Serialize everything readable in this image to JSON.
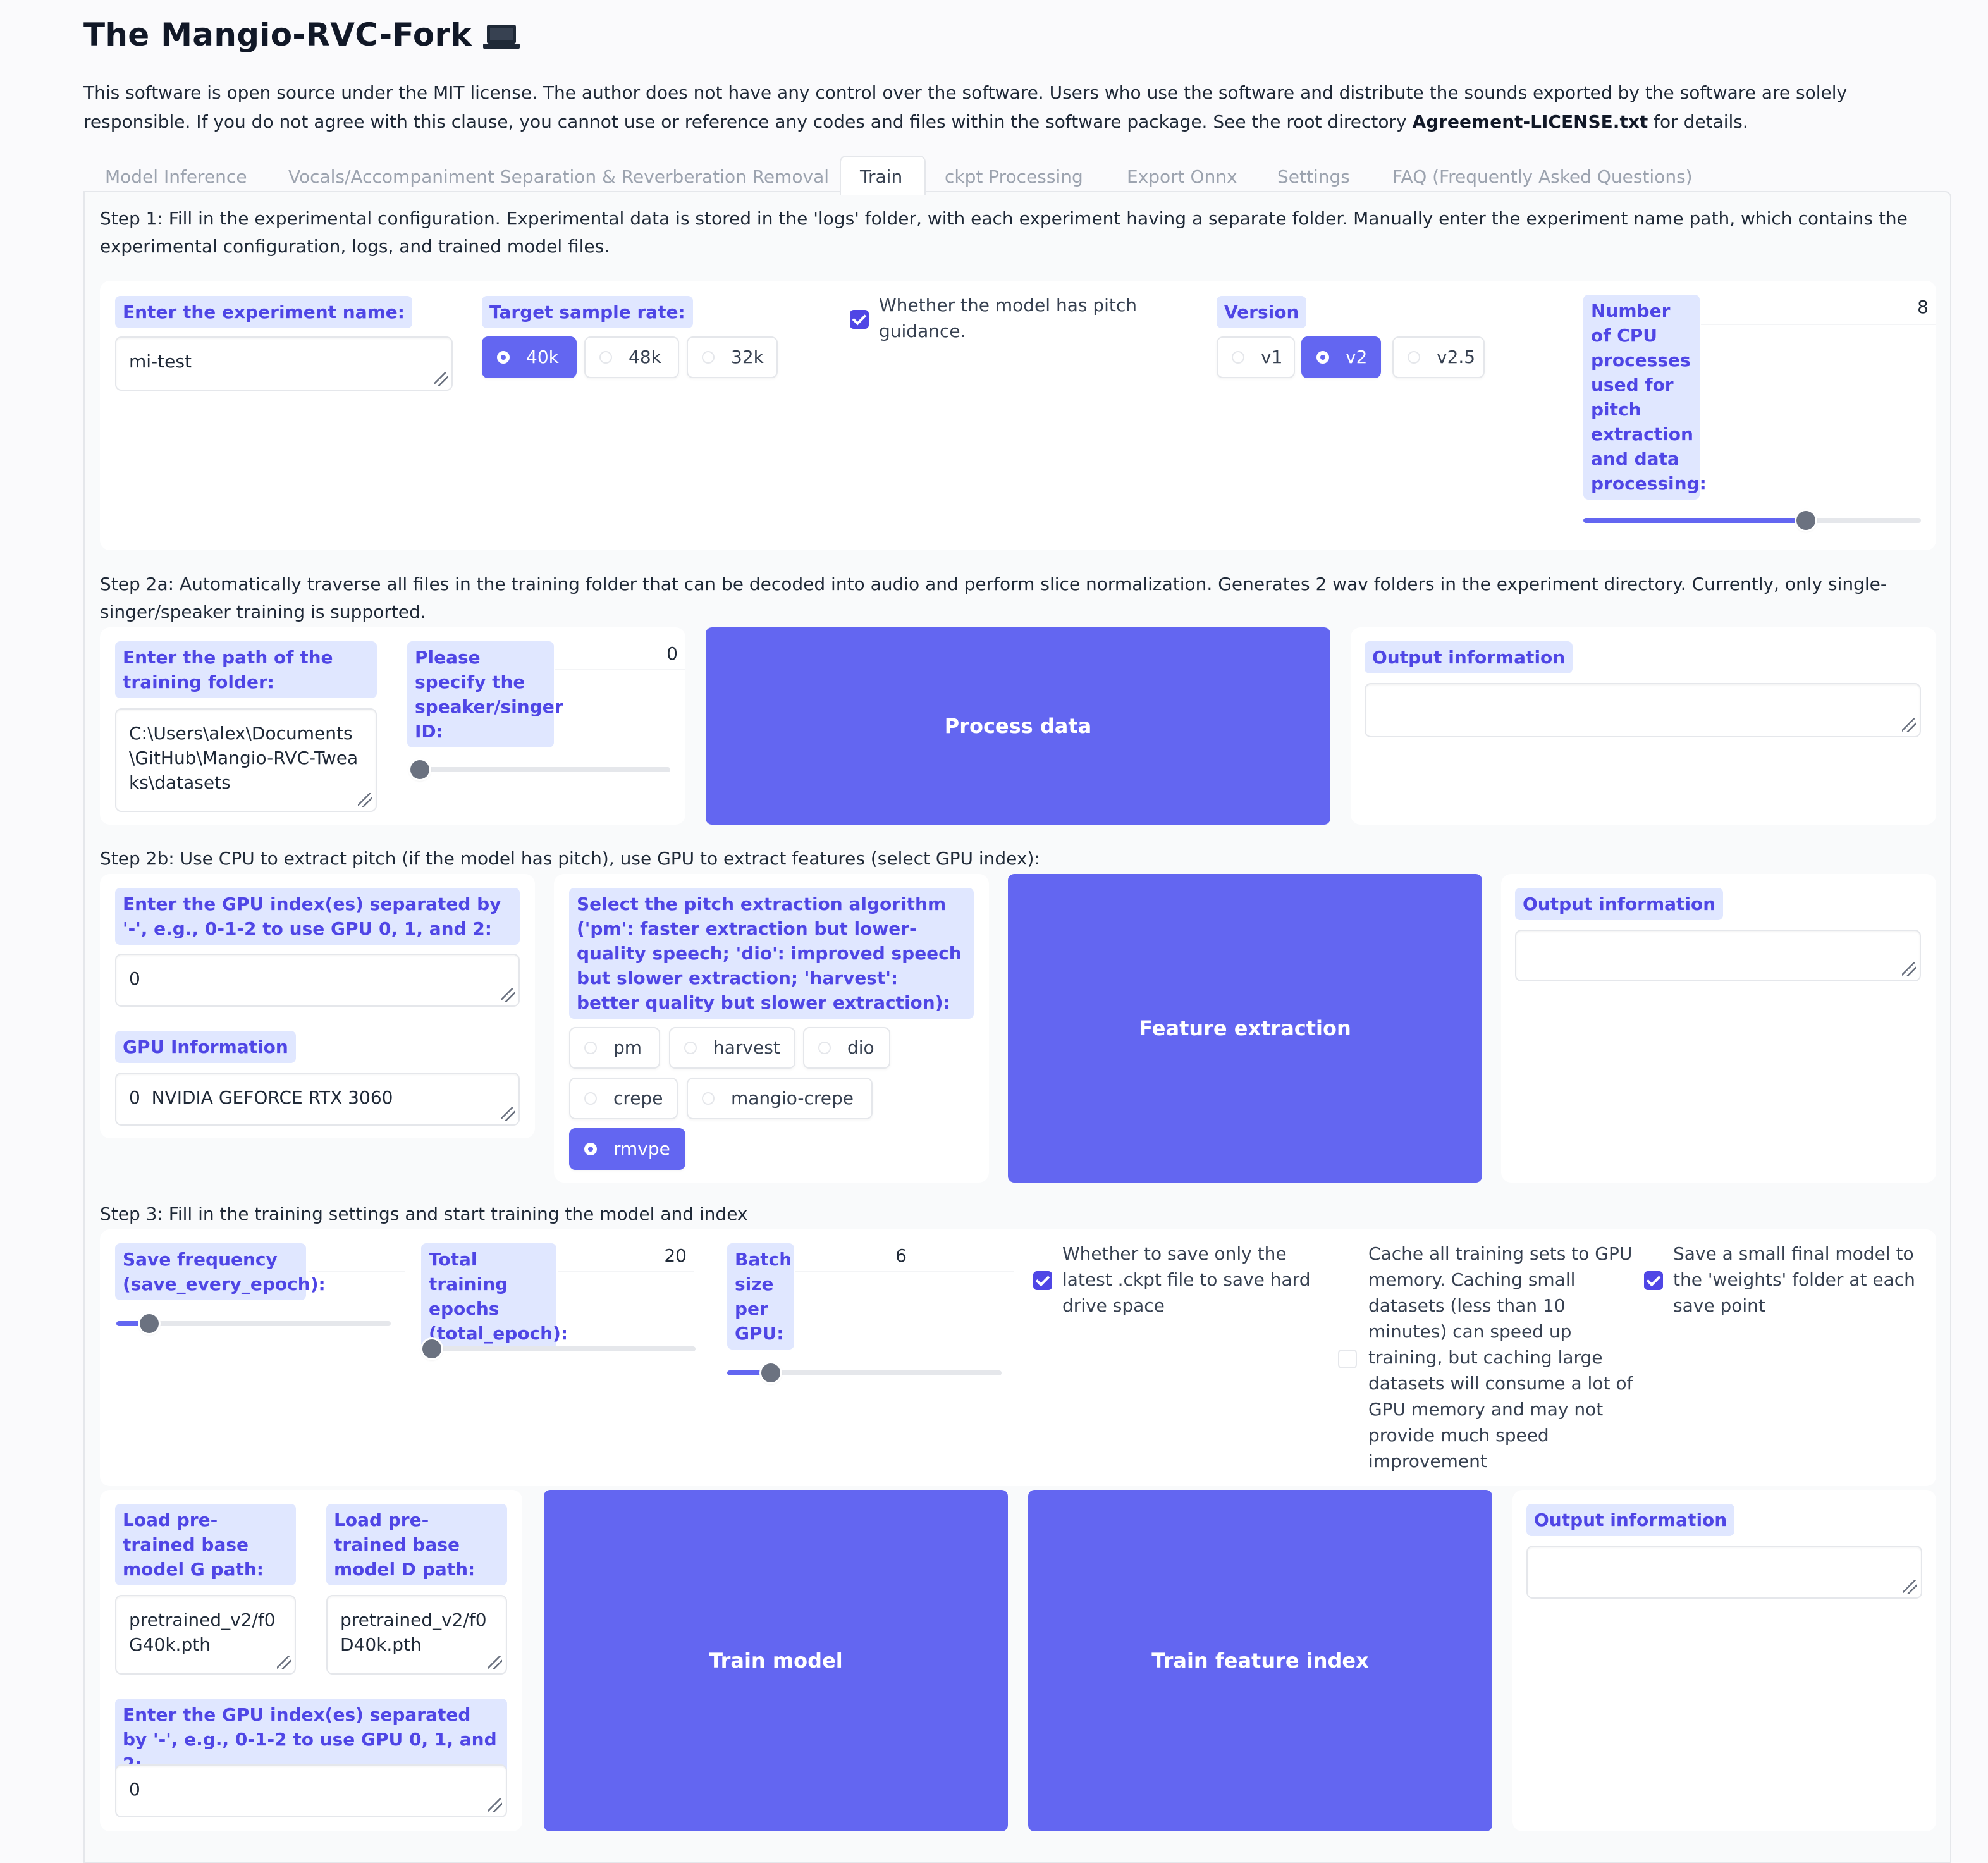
{
  "app": {
    "title": "The Mangio-RVC-Fork",
    "description_pre": "This software is open source under the MIT license. The author does not have any control over the software. Users who use the software and distribute the sounds exported by the software are solely responsible. If you do not agree with this clause, you cannot use or reference any codes and files within the software package. See the root directory ",
    "description_bold": "Agreement-LICENSE.txt",
    "description_post": " for details."
  },
  "tabs": [
    {
      "label": "Model Inference"
    },
    {
      "label": "Vocals/Accompaniment Separation & Reverberation Removal"
    },
    {
      "label": "Train"
    },
    {
      "label": "ckpt Processing"
    },
    {
      "label": "Export Onnx"
    },
    {
      "label": "Settings"
    },
    {
      "label": "FAQ (Frequently Asked Questions)"
    }
  ],
  "step1": {
    "text": "Step 1: Fill in the experimental configuration. Experimental data is stored in the 'logs' folder, with each experiment having a separate folder. Manually enter the experiment name path, which contains the experimental configuration, logs, and trained model files.",
    "exp_name_label": "Enter the experiment name:",
    "exp_name_value": "mi-test",
    "sr_label": "Target sample rate:",
    "sr_options": [
      "40k",
      "48k",
      "32k"
    ],
    "pitch_label": "Whether the model has pitch guidance.",
    "version_label": "Version",
    "version_options": [
      "v1",
      "v2",
      "v2.5"
    ],
    "cpu_label": "Number of CPU processes used for pitch extraction and data processing:",
    "cpu_value": "8",
    "cpu_fraction": 0.66
  },
  "step2a": {
    "text": "Step 2a: Automatically traverse all files in the training folder that can be decoded into audio and perform slice normalization. Generates 2 wav folders in the experiment directory. Currently, only single-singer/speaker training is supported.",
    "path_label": "Enter the path of the training folder:",
    "path_value": "C:\\Users\\alex\\Documents\\GitHub\\Mangio-RVC-Tweaks\\datasets",
    "speaker_label": "Please specify the speaker/singer ID:",
    "speaker_value": "0",
    "speaker_fraction": 0.0,
    "process_button": "Process data",
    "output_label": "Output information"
  },
  "step2b": {
    "text": "Step 2b: Use CPU to extract pitch (if the model has pitch), use GPU to extract features (select GPU index):",
    "gpu_label": "Enter the GPU index(es) separated by '-', e.g., 0-1-2 to use GPU 0, 1, and 2:",
    "gpu_value": "0",
    "gpu_info_label": "GPU Information",
    "gpu_info_value": "0  NVIDIA GEFORCE RTX 3060",
    "algo_label": "Select the pitch extraction algorithm ('pm': faster extraction but lower-quality speech; 'dio': improved speech but slower extraction; 'harvest': better quality but slower extraction):",
    "algo_options": [
      "pm",
      "harvest",
      "dio",
      "crepe",
      "mangio-crepe",
      "rmvpe"
    ],
    "extract_button": "Feature extraction",
    "output_label": "Output information"
  },
  "step3": {
    "text": "Step 3: Fill in the training settings and start training the model and index",
    "save_freq_label": "Save frequency (save_every_epoch):",
    "save_freq_fraction": 0.12,
    "epochs_label": "Total training epochs (total_epoch):",
    "epochs_value": "20",
    "epochs_fraction": 0.04,
    "batch_label": "Batch size per GPU:",
    "batch_value": "6",
    "batch_fraction": 0.16,
    "save_latest_label": "Whether to save only the latest .ckpt file to save hard drive space",
    "cache_label": "Cache all training sets to GPU memory. Caching small datasets (less than 10 minutes) can speed up training, but caching large datasets will consume a lot of GPU memory and may not provide much speed improvement",
    "save_small_label": "Save a small final model to the 'weights' folder at each save point",
    "g_path_label": "Load pre-trained base model G path:",
    "g_path_value": "pretrained_v2/f0G40k.pth",
    "d_path_label": "Load pre-trained base model D path:",
    "d_path_value": "pretrained_v2/f0D40k.pth",
    "gpu_label": "Enter the GPU index(es) separated by '-', e.g., 0-1-2 to use GPU 0, 1, and 2:",
    "gpu_value": "0",
    "train_button": "Train model",
    "index_button": "Train feature index",
    "output_label": "Output information"
  }
}
